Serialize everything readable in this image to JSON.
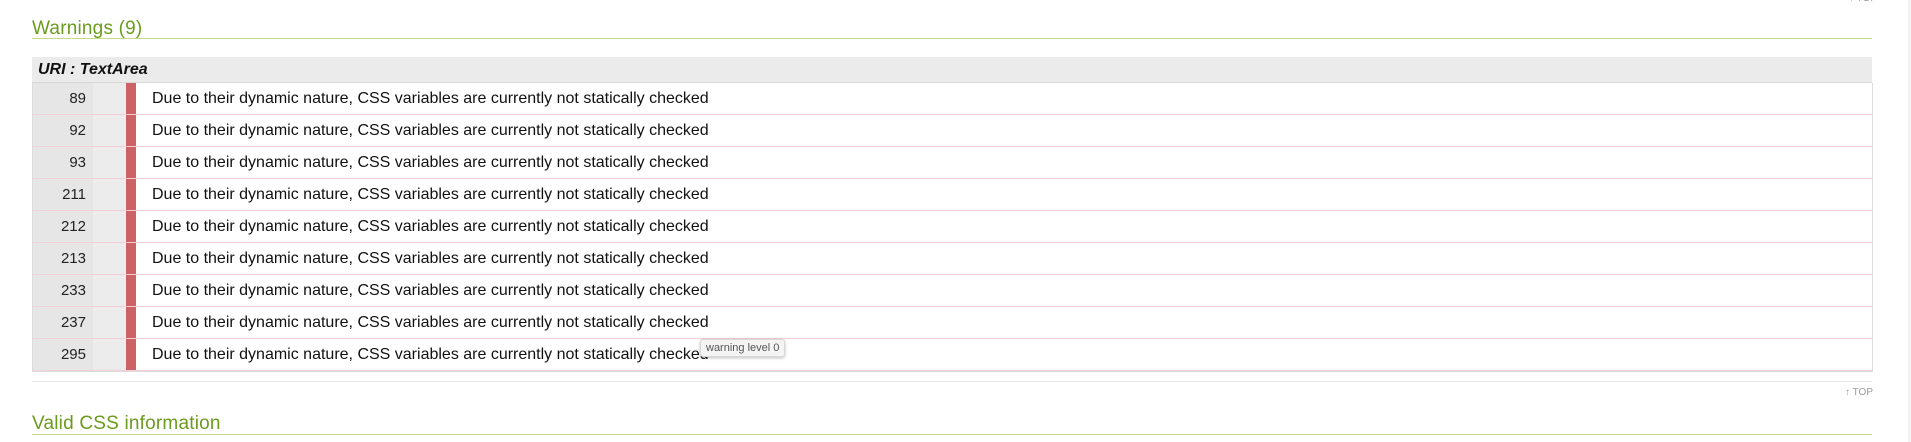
{
  "warnings_section": {
    "title": "Warnings (9)",
    "uri_label": "URI : TextArea",
    "rows": [
      {
        "line": "89",
        "message": "Due to their dynamic nature, CSS variables are currently not statically checked"
      },
      {
        "line": "92",
        "message": "Due to their dynamic nature, CSS variables are currently not statically checked"
      },
      {
        "line": "93",
        "message": "Due to their dynamic nature, CSS variables are currently not statically checked"
      },
      {
        "line": "211",
        "message": "Due to their dynamic nature, CSS variables are currently not statically checked"
      },
      {
        "line": "212",
        "message": "Due to their dynamic nature, CSS variables are currently not statically checked"
      },
      {
        "line": "213",
        "message": "Due to their dynamic nature, CSS variables are currently not statically checked"
      },
      {
        "line": "233",
        "message": "Due to their dynamic nature, CSS variables are currently not statically checked"
      },
      {
        "line": "237",
        "message": "Due to their dynamic nature, CSS variables are currently not statically checked"
      },
      {
        "line": "295",
        "message": "Due to their dynamic nature, CSS variables are currently not statically checked"
      }
    ],
    "tooltip": "warning level 0",
    "level_color": "#cc6166",
    "top_link": "↑ TOP"
  },
  "valid_section": {
    "title": "Valid CSS information"
  },
  "colors": {
    "section_title": "#6b9b1e",
    "row_divider": "#f1cfd4"
  }
}
